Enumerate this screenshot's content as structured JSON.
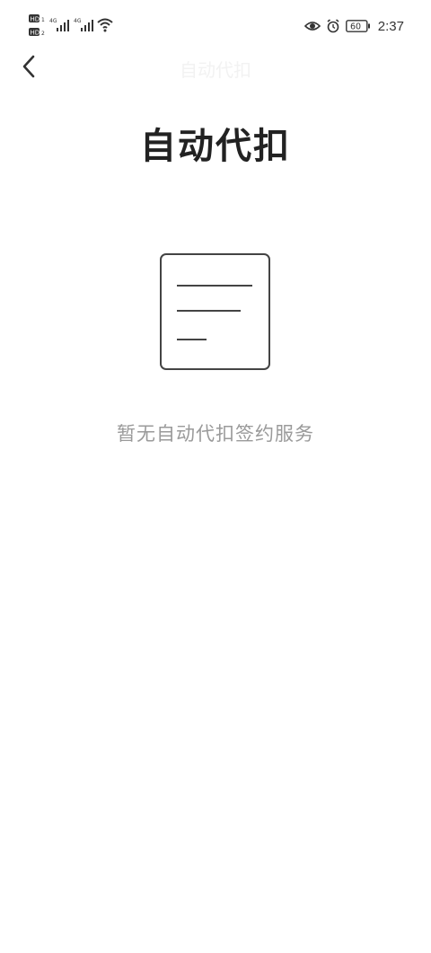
{
  "status_bar": {
    "network_left": "HD",
    "network_type_1": "4G",
    "network_type_2": "4G",
    "battery": "60",
    "time": "2:37"
  },
  "nav": {
    "title": "自动代扣",
    "back_icon": "chevron-left-icon"
  },
  "main": {
    "title": "自动代扣",
    "empty_message": "暂无自动代扣签约服务",
    "empty_icon": "document-icon"
  },
  "colors": {
    "title": "#222222",
    "empty_text": "#9a9a9a",
    "icon_stroke": "#444444",
    "background": "#ffffff"
  }
}
